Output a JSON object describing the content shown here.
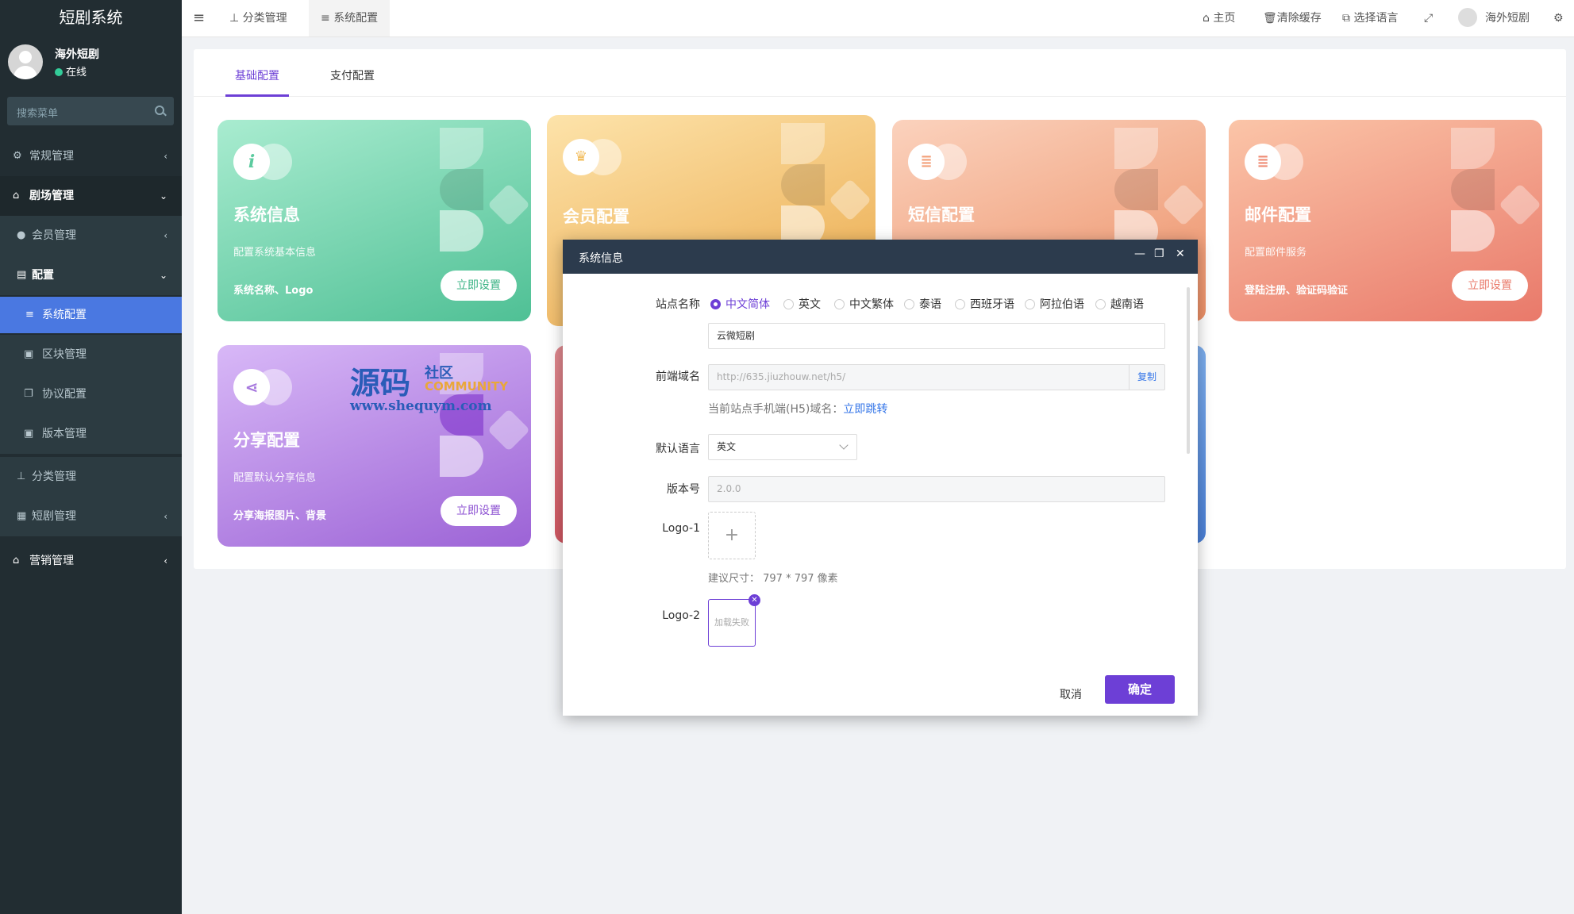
{
  "sidebar": {
    "title": "短剧系统",
    "user_name": "海外短剧",
    "status": "在线",
    "search_placeholder": "搜索菜单",
    "items": [
      {
        "label": "常规管理",
        "icon": "cogs-icon"
      },
      {
        "label": "剧场管理",
        "icon": "home-icon"
      },
      {
        "label": "会员管理",
        "icon": "user-icon"
      },
      {
        "label": "配置",
        "icon": "file-icon"
      },
      {
        "label": "系统配置",
        "icon": "sliders-icon"
      },
      {
        "label": "区块管理",
        "icon": "image-icon"
      },
      {
        "label": "协议配置",
        "icon": "copy-icon"
      },
      {
        "label": "版本管理",
        "icon": "image-icon"
      },
      {
        "label": "分类管理",
        "icon": "sitemap-icon"
      },
      {
        "label": "短剧管理",
        "icon": "suitcase-icon"
      },
      {
        "label": "营销管理",
        "icon": "home-icon"
      }
    ]
  },
  "topbar": {
    "tabs": [
      {
        "label": "分类管理",
        "icon": "sitemap-icon"
      },
      {
        "label": "系统配置",
        "icon": "sliders-icon"
      }
    ],
    "home": "主页",
    "clear_cache": "清除缓存",
    "language": "选择语言",
    "user": "海外短剧"
  },
  "config_tabs": [
    "基础配置",
    "支付配置"
  ],
  "cards": [
    {
      "title": "系统信息",
      "desc": "配置系统基本信息",
      "feature": "系统名称、Logo",
      "button": "立即设置",
      "color": "#5ccb9f"
    },
    {
      "title": "会员配置",
      "color": "#f2bc5a"
    },
    {
      "title": "短信配置",
      "color": "#f3a079"
    },
    {
      "title": "邮件配置",
      "desc": "配置邮件服务",
      "feature": "登陆注册、验证码验证",
      "button": "立即设置",
      "color": "#ef8b74"
    },
    {
      "title": "分享配置",
      "desc": "配置默认分享信息",
      "feature": "分享海报图片、背景",
      "button": "立即设置",
      "color": "#a779de"
    }
  ],
  "watermark": {
    "line1": "源码",
    "line2": "社区",
    "line3": "COMMUNITY",
    "url": "www.shequym.com"
  },
  "modal": {
    "title": "系统信息",
    "site_name_label": "站点名称",
    "langs": [
      "中文简体",
      "英文",
      "中文繁体",
      "泰语",
      "西班牙语",
      "阿拉伯语",
      "越南语"
    ],
    "site_name_value": "云微短剧",
    "domain_label": "前端域名",
    "domain_value": "http://635.jiuzhouw.net/h5/",
    "copy": "复制",
    "domain_hint": "当前站点手机端(H5)域名：",
    "jump": "立即跳转",
    "default_lang_label": "默认语言",
    "default_lang_value": "英文",
    "version_label": "版本号",
    "version_value": "2.0.0",
    "logo1_label": "Logo-1",
    "logo1_hint": "建议尺寸：  797 * 797 像素",
    "logo2_label": "Logo-2",
    "logo2_failed": "加载失败",
    "cancel": "取消",
    "confirm": "确定"
  }
}
